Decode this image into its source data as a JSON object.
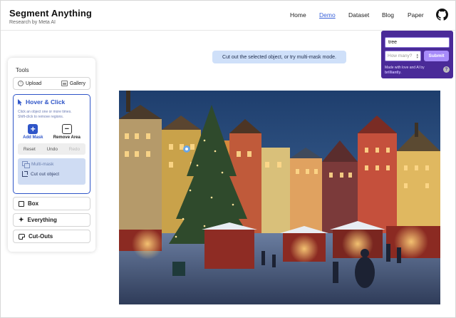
{
  "header": {
    "title": "Segment Anything",
    "subtitle": "Research by Meta AI",
    "nav": [
      {
        "label": "Home",
        "active": false
      },
      {
        "label": "Demo",
        "active": true
      },
      {
        "label": "Dataset",
        "active": false
      },
      {
        "label": "Blog",
        "active": false
      },
      {
        "label": "Paper",
        "active": false
      }
    ],
    "github_icon": "github-icon"
  },
  "popup": {
    "text_value": "tree",
    "count_placeholder": "How many?",
    "submit_label": "Submit",
    "credit_prefix": "Made with love and AI by",
    "credit_brand": "brilliantly",
    "credit_suffix": ".",
    "help_label": "?",
    "background_color": "#4a2a98",
    "submit_color": "#a78bfa"
  },
  "hint": {
    "text": "Cut out the selected object, or try multi-mask mode."
  },
  "tools": {
    "title": "Tools",
    "upload_label": "Upload",
    "gallery_label": "Gallery",
    "hover_click": {
      "label": "Hover & Click",
      "description_line1": "Click an object one or more times.",
      "description_line2": "Shift-click to remove regions.",
      "add_mask_label": "Add Mask",
      "remove_area_label": "Remove Area",
      "reset_label": "Reset",
      "undo_label": "Undo",
      "redo_label": "Redo",
      "multi_mask_label": "Multi-mask",
      "cut_out_label": "Cut out object",
      "accent_color": "#2f55c8"
    },
    "items": [
      {
        "label": "Box",
        "icon": "box-icon"
      },
      {
        "label": "Everything",
        "icon": "sparkle-icon"
      },
      {
        "label": "Cut-Outs",
        "icon": "cutouts-icon"
      }
    ]
  },
  "photo": {
    "subject": "christmas-market-square-photo"
  }
}
